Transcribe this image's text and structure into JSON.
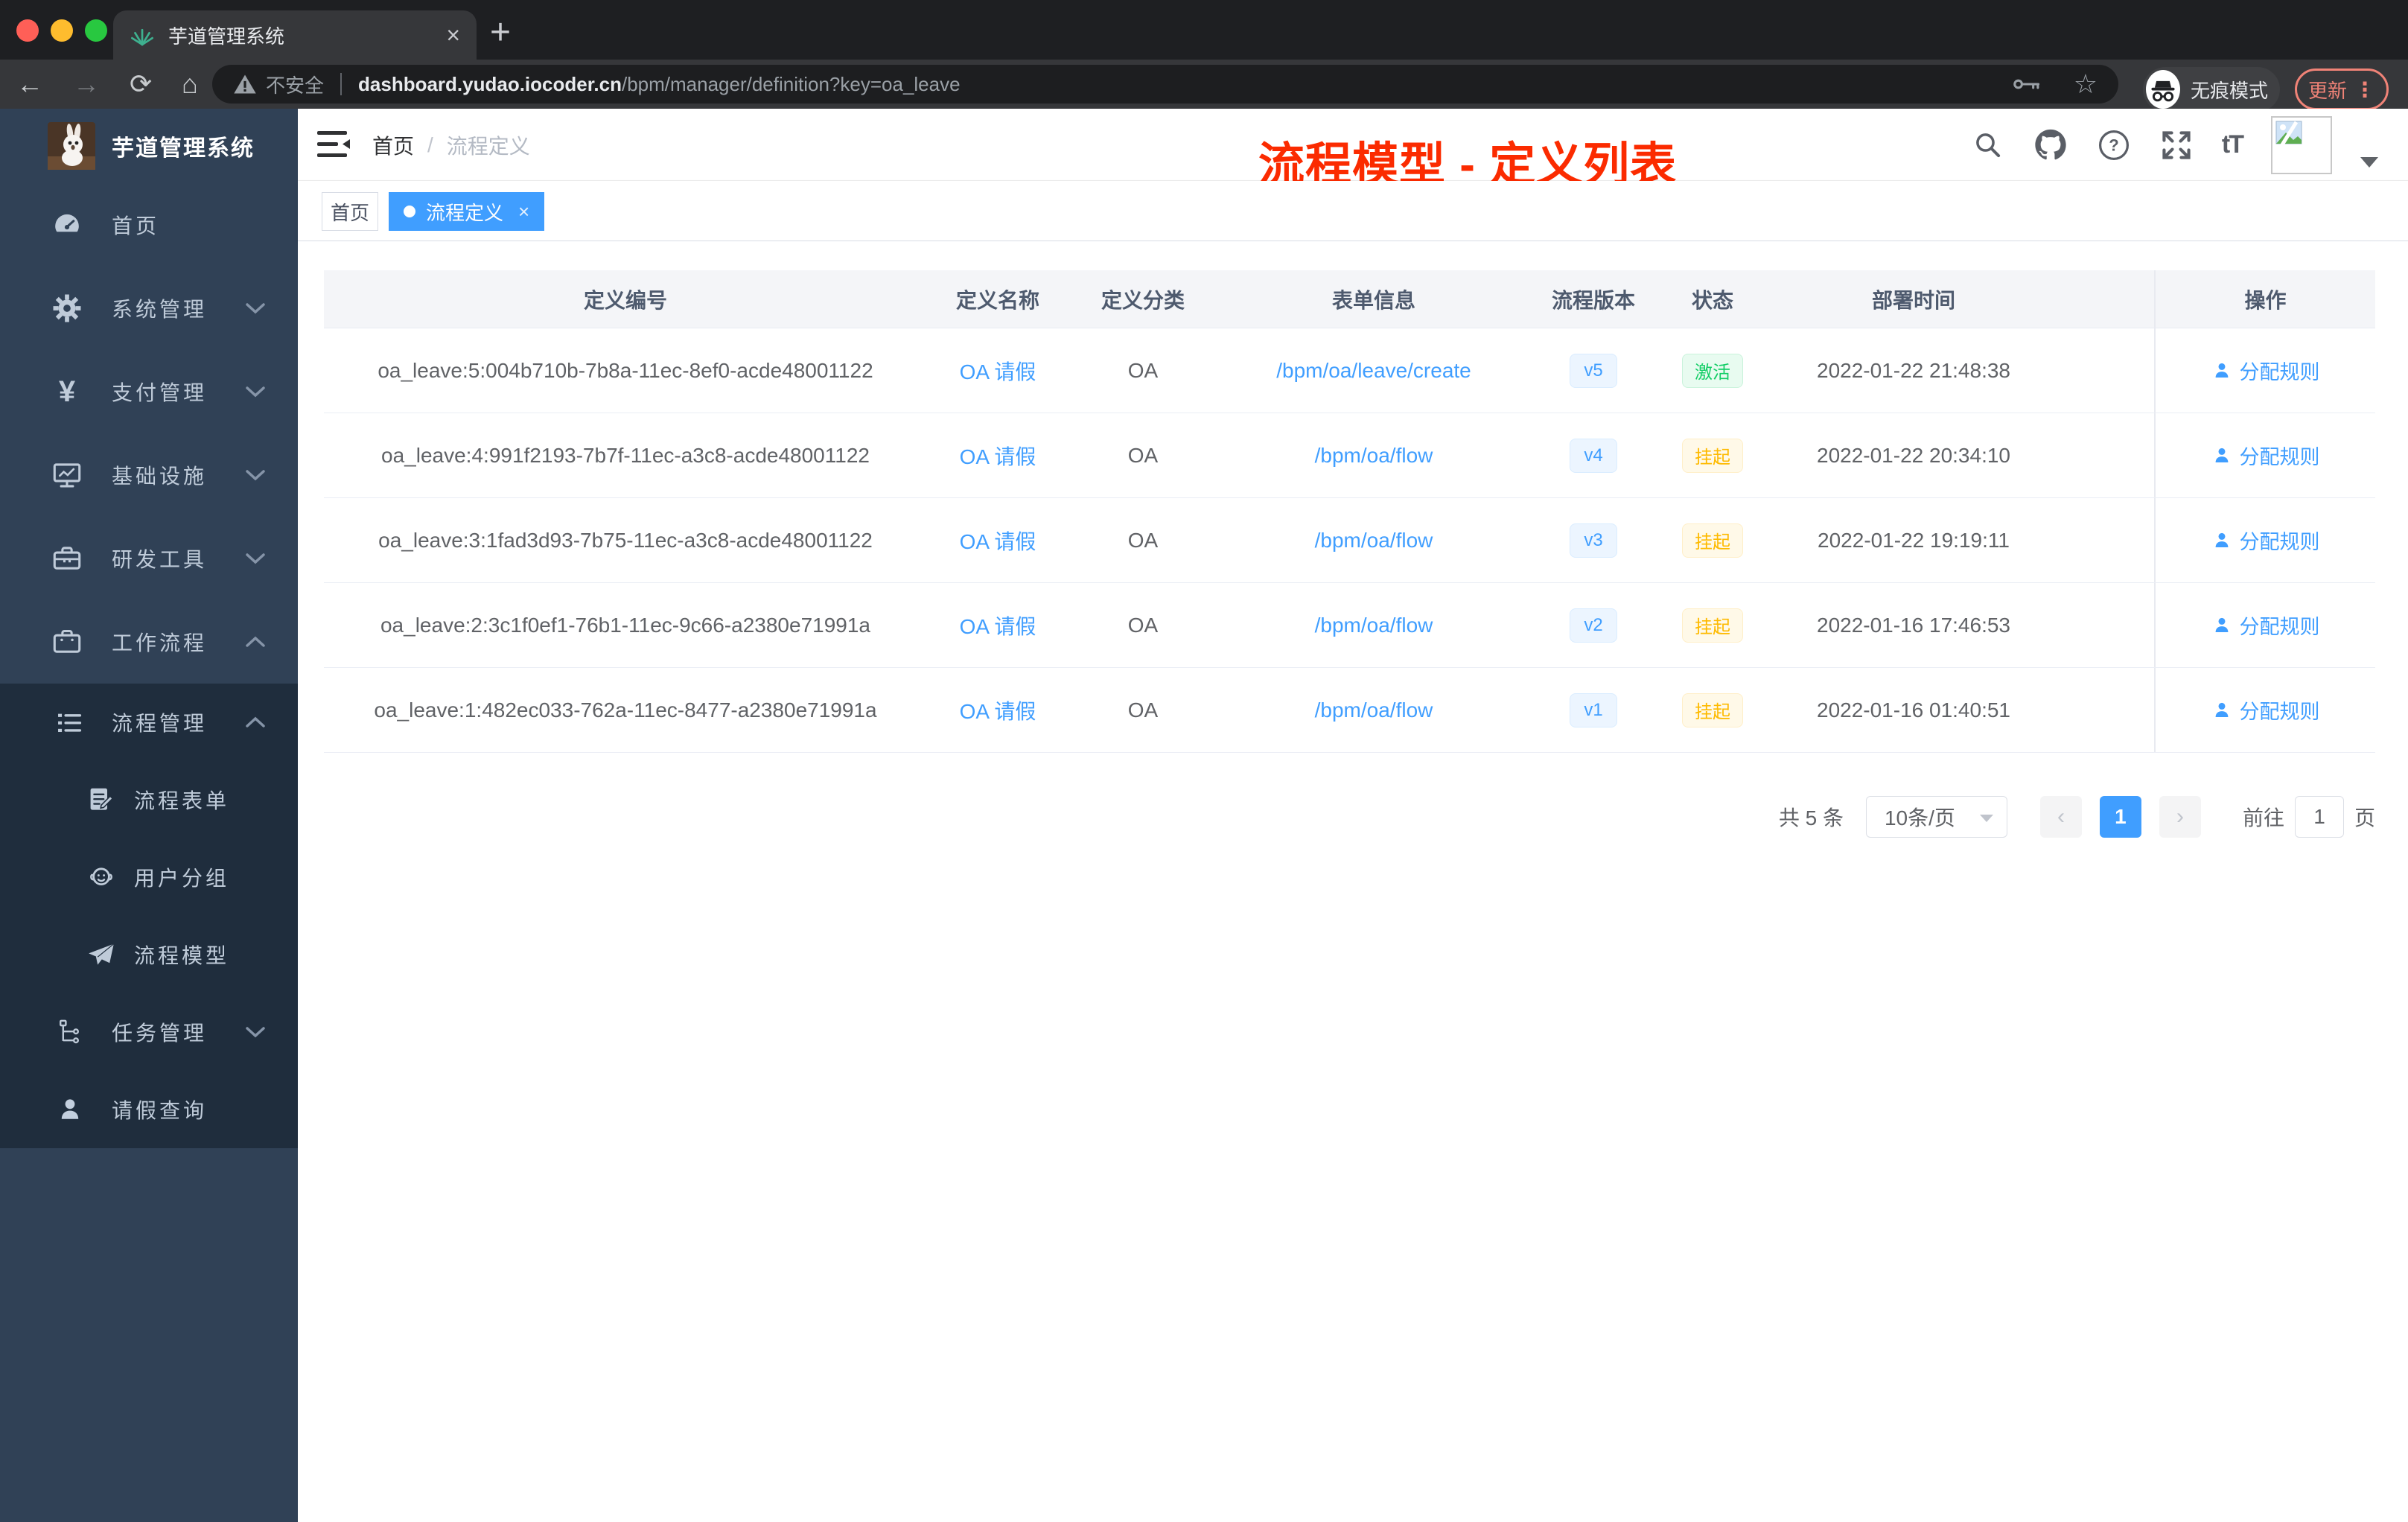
{
  "browser": {
    "tab_title": "芋道管理系统",
    "tab_close_glyph": "×",
    "new_tab_glyph": "+",
    "back_glyph": "←",
    "forward_glyph": "→",
    "reload_glyph": "⟳",
    "home_glyph": "⌂",
    "security_label": "不安全",
    "url_host": "dashboard.yudao.iocoder.cn",
    "url_path": "/bpm/manager/definition?key=oa_leave",
    "star_glyph": "☆",
    "incognito_label": "无痕模式",
    "update_label": "更新",
    "menu_dots_glyph": "⋮"
  },
  "sidebar": {
    "logo_title": "芋道管理系统",
    "yen_glyph": "¥",
    "menu": [
      {
        "label": "首页"
      },
      {
        "label": "系统管理"
      },
      {
        "label": "支付管理"
      },
      {
        "label": "基础设施"
      },
      {
        "label": "研发工具"
      },
      {
        "label": "工作流程"
      }
    ],
    "submenu": [
      {
        "label": "流程管理"
      },
      {
        "label": "流程表单"
      },
      {
        "label": "用户分组"
      },
      {
        "label": "流程模型"
      },
      {
        "label": "任务管理"
      },
      {
        "label": "请假查询"
      }
    ]
  },
  "header": {
    "breadcrumb_home": "首页",
    "breadcrumb_sep": "/",
    "breadcrumb_current": "流程定义",
    "annotation": "流程模型 - 定义列表",
    "textsize_glyph": "tT"
  },
  "tags": {
    "home": "首页",
    "current": "流程定义",
    "close_glyph": "×"
  },
  "table": {
    "columns": [
      "定义编号",
      "定义名称",
      "定义分类",
      "表单信息",
      "流程版本",
      "状态",
      "部署时间",
      "操作"
    ],
    "rows": [
      {
        "id": "oa_leave:5:004b710b-7b8a-11ec-8ef0-acde48001122",
        "name": "OA 请假",
        "category": "OA",
        "form": "/bpm/oa/leave/create",
        "version": "v5",
        "status": "激活",
        "deploy_time": "2022-01-22 21:48:38",
        "action": "分配规则"
      },
      {
        "id": "oa_leave:4:991f2193-7b7f-11ec-a3c8-acde48001122",
        "name": "OA 请假",
        "category": "OA",
        "form": "/bpm/oa/flow",
        "version": "v4",
        "status": "挂起",
        "deploy_time": "2022-01-22 20:34:10",
        "action": "分配规则"
      },
      {
        "id": "oa_leave:3:1fad3d93-7b75-11ec-a3c8-acde48001122",
        "name": "OA 请假",
        "category": "OA",
        "form": "/bpm/oa/flow",
        "version": "v3",
        "status": "挂起",
        "deploy_time": "2022-01-22 19:19:11",
        "action": "分配规则"
      },
      {
        "id": "oa_leave:2:3c1f0ef1-76b1-11ec-9c66-a2380e71991a",
        "name": "OA 请假",
        "category": "OA",
        "form": "/bpm/oa/flow",
        "version": "v2",
        "status": "挂起",
        "deploy_time": "2022-01-16 17:46:53",
        "action": "分配规则"
      },
      {
        "id": "oa_leave:1:482ec033-762a-11ec-8477-a2380e71991a",
        "name": "OA 请假",
        "category": "OA",
        "form": "/bpm/oa/flow",
        "version": "v1",
        "status": "挂起",
        "deploy_time": "2022-01-16 01:40:51",
        "action": "分配规则"
      }
    ]
  },
  "pagination": {
    "total": "共 5 条",
    "page_size": "10条/页",
    "prev_glyph": "‹",
    "next_glyph": "›",
    "page": "1",
    "goto": "前往",
    "goto_value": "1",
    "page_unit": "页"
  },
  "colors": {
    "accent": "#409eff",
    "success": "#13ce66",
    "warning": "#ffba00",
    "annotation_red": "#fb2b00",
    "sidebar_bg": "#304156",
    "submenu_bg": "#1f2d3d"
  }
}
